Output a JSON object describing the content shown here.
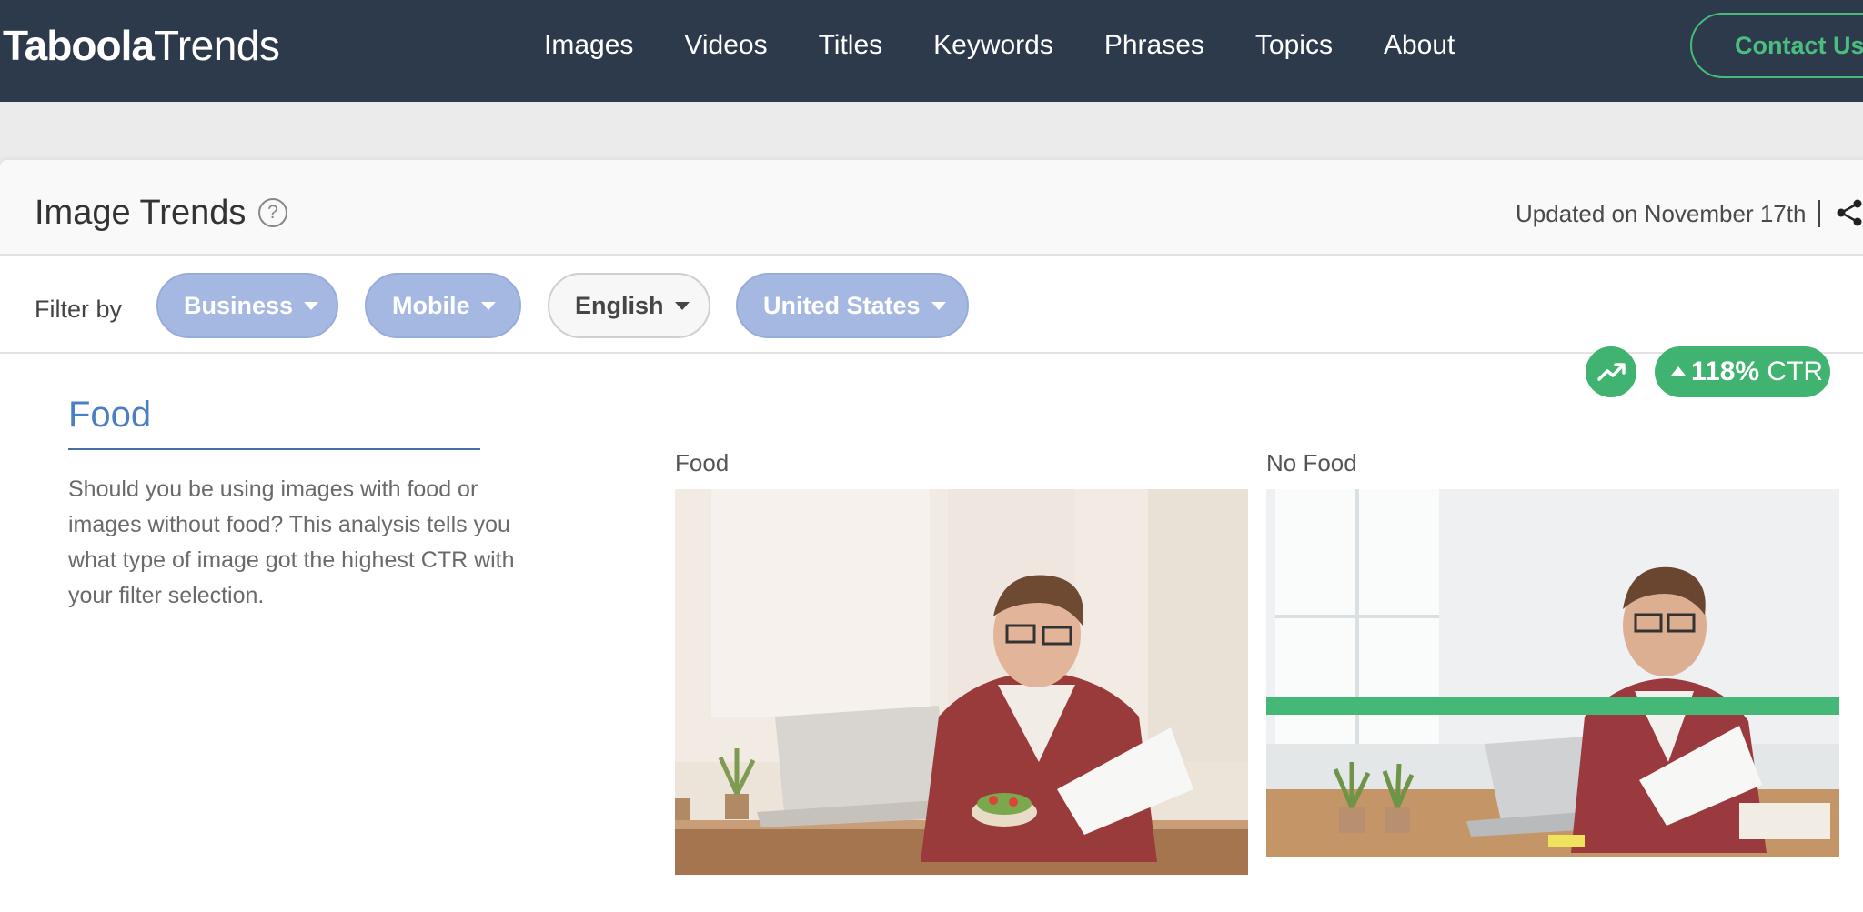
{
  "nav": {
    "logo_bold": "Taboola",
    "logo_light": "Trends",
    "links": [
      "Images",
      "Videos",
      "Titles",
      "Keywords",
      "Phrases",
      "Topics",
      "About"
    ],
    "contact_label": "Contact Us"
  },
  "header": {
    "title": "Image Trends",
    "help_symbol": "?",
    "updated": "Updated on November 17th"
  },
  "filters": {
    "label": "Filter by",
    "pills": [
      {
        "label": "Business",
        "active": true
      },
      {
        "label": "Mobile",
        "active": true
      },
      {
        "label": "English",
        "active": false
      },
      {
        "label": "United States",
        "active": true
      }
    ]
  },
  "topic": {
    "title": "Food",
    "description": "Should you be using images with food or images without food? This analysis tells you what type of image got the highest CTR with your filter selection."
  },
  "comparison": {
    "left_label": "Food",
    "right_label": "No Food",
    "ctr_value": "118%",
    "ctr_suffix": "CTR"
  },
  "colors": {
    "nav_bg": "#2d3a4c",
    "accent_green": "#3fb36f",
    "pill_active": "#a4b8e1",
    "topic_blue": "#4a7fc1"
  },
  "icons": [
    "help-icon",
    "share-icon",
    "trend-up-icon",
    "caret-down-icon",
    "arrow-up-icon"
  ]
}
